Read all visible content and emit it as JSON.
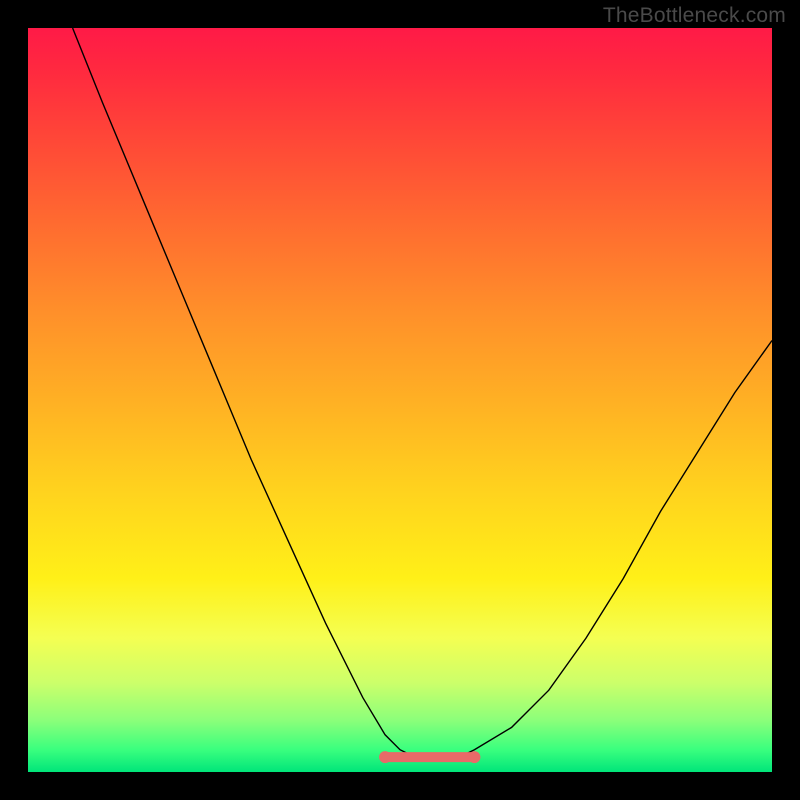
{
  "watermark": "TheBottleneck.com",
  "chart_data": {
    "type": "line",
    "title": "",
    "xlabel": "",
    "ylabel": "",
    "xlim": [
      0,
      100
    ],
    "ylim": [
      0,
      100
    ],
    "grid": false,
    "legend": false,
    "series": [
      {
        "name": "curve",
        "color": "#000000",
        "x": [
          6,
          10,
          15,
          20,
          25,
          30,
          35,
          40,
          45,
          48,
          50,
          52,
          55,
          58,
          60,
          65,
          70,
          75,
          80,
          85,
          90,
          95,
          100
        ],
        "y": [
          100,
          90,
          78,
          66,
          54,
          42,
          31,
          20,
          10,
          5,
          3,
          2,
          2,
          2,
          3,
          6,
          11,
          18,
          26,
          35,
          43,
          51,
          58
        ]
      }
    ],
    "highlight": {
      "name": "optimal-range",
      "color": "#e96a68",
      "x_start": 48,
      "x_end": 60,
      "y": 2,
      "endpoints": true
    },
    "background_gradient": {
      "top_color": "#ff1a47",
      "bottom_color": "#00e57a",
      "description": "red-orange-yellow-green vertical gradient"
    }
  }
}
